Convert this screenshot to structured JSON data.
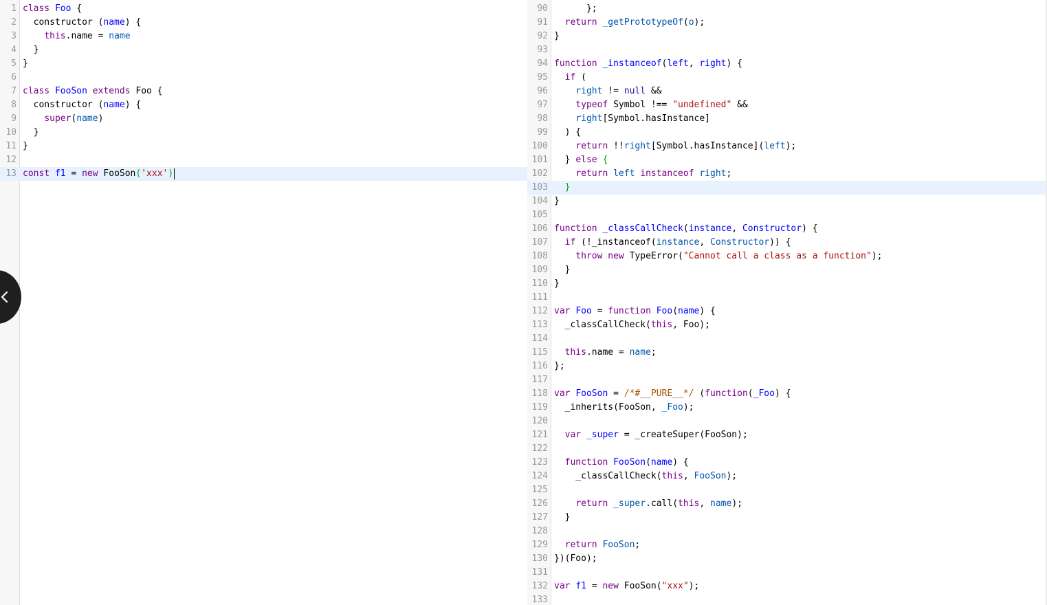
{
  "left_editor": {
    "active_line": "13",
    "lines": [
      {
        "no": "1",
        "tokens": [
          {
            "t": "class",
            "c": "keyword"
          },
          {
            "t": " "
          },
          {
            "t": "Foo",
            "c": "def"
          },
          {
            "t": " {"
          }
        ]
      },
      {
        "no": "2",
        "tokens": [
          {
            "t": "  constructor "
          },
          {
            "t": "("
          },
          {
            "t": "name",
            "c": "def"
          },
          {
            "t": ") {"
          }
        ]
      },
      {
        "no": "3",
        "tokens": [
          {
            "t": "    "
          },
          {
            "t": "this",
            "c": "keyword"
          },
          {
            "t": ".name = "
          },
          {
            "t": "name",
            "c": "var2"
          }
        ]
      },
      {
        "no": "4",
        "tokens": [
          {
            "t": "  }"
          }
        ]
      },
      {
        "no": "5",
        "tokens": [
          {
            "t": "}"
          }
        ]
      },
      {
        "no": "6",
        "tokens": []
      },
      {
        "no": "7",
        "tokens": [
          {
            "t": "class",
            "c": "keyword"
          },
          {
            "t": " "
          },
          {
            "t": "FooSon",
            "c": "def"
          },
          {
            "t": " "
          },
          {
            "t": "extends",
            "c": "keyword"
          },
          {
            "t": " Foo {"
          }
        ]
      },
      {
        "no": "8",
        "tokens": [
          {
            "t": "  constructor "
          },
          {
            "t": "("
          },
          {
            "t": "name",
            "c": "def"
          },
          {
            "t": ") {"
          }
        ]
      },
      {
        "no": "9",
        "tokens": [
          {
            "t": "    "
          },
          {
            "t": "super",
            "c": "keyword"
          },
          {
            "t": "("
          },
          {
            "t": "name",
            "c": "var2"
          },
          {
            "t": ")"
          }
        ]
      },
      {
        "no": "10",
        "tokens": [
          {
            "t": "  }"
          }
        ]
      },
      {
        "no": "11",
        "tokens": [
          {
            "t": "}"
          }
        ]
      },
      {
        "no": "12",
        "tokens": []
      },
      {
        "no": "13",
        "tokens": [
          {
            "t": "const",
            "c": "keyword"
          },
          {
            "t": " "
          },
          {
            "t": "f1",
            "c": "def"
          },
          {
            "t": " = "
          },
          {
            "t": "new",
            "c": "keyword"
          },
          {
            "t": " FooSon"
          },
          {
            "t": "(",
            "c": "bracket-match"
          },
          {
            "t": "'xxx'",
            "c": "str"
          },
          {
            "t": ")",
            "c": "bracket-match"
          }
        ],
        "cursor": true
      }
    ]
  },
  "right_editor": {
    "active_line": "103",
    "lines": [
      {
        "no": "90",
        "tokens": [
          {
            "t": "      };"
          }
        ]
      },
      {
        "no": "91",
        "tokens": [
          {
            "t": "  "
          },
          {
            "t": "return",
            "c": "keyword"
          },
          {
            "t": " "
          },
          {
            "t": "_getPrototypeOf",
            "c": "var2"
          },
          {
            "t": "("
          },
          {
            "t": "o",
            "c": "var2"
          },
          {
            "t": ");"
          }
        ]
      },
      {
        "no": "92",
        "tokens": [
          {
            "t": "}"
          }
        ]
      },
      {
        "no": "93",
        "tokens": []
      },
      {
        "no": "94",
        "tokens": [
          {
            "t": "function",
            "c": "keyword"
          },
          {
            "t": " "
          },
          {
            "t": "_instanceof",
            "c": "def"
          },
          {
            "t": "("
          },
          {
            "t": "left",
            "c": "def"
          },
          {
            "t": ", "
          },
          {
            "t": "right",
            "c": "def"
          },
          {
            "t": ") {"
          }
        ]
      },
      {
        "no": "95",
        "tokens": [
          {
            "t": "  "
          },
          {
            "t": "if",
            "c": "keyword"
          },
          {
            "t": " ("
          }
        ]
      },
      {
        "no": "96",
        "tokens": [
          {
            "t": "    "
          },
          {
            "t": "right",
            "c": "var2"
          },
          {
            "t": " != "
          },
          {
            "t": "null",
            "c": "atom"
          },
          {
            "t": " &&"
          }
        ]
      },
      {
        "no": "97",
        "tokens": [
          {
            "t": "    "
          },
          {
            "t": "typeof",
            "c": "keyword"
          },
          {
            "t": " Symbol !== "
          },
          {
            "t": "\"undefined\"",
            "c": "str"
          },
          {
            "t": " &&"
          }
        ]
      },
      {
        "no": "98",
        "tokens": [
          {
            "t": "    "
          },
          {
            "t": "right",
            "c": "var2"
          },
          {
            "t": "[Symbol.hasInstance]"
          }
        ]
      },
      {
        "no": "99",
        "tokens": [
          {
            "t": "  ) {"
          }
        ]
      },
      {
        "no": "100",
        "tokens": [
          {
            "t": "    "
          },
          {
            "t": "return",
            "c": "keyword"
          },
          {
            "t": " !!"
          },
          {
            "t": "right",
            "c": "var2"
          },
          {
            "t": "[Symbol.hasInstance]("
          },
          {
            "t": "left",
            "c": "var2"
          },
          {
            "t": ");"
          }
        ]
      },
      {
        "no": "101",
        "tokens": [
          {
            "t": "  } "
          },
          {
            "t": "else",
            "c": "keyword"
          },
          {
            "t": " "
          },
          {
            "t": "{",
            "c": "bracket-match"
          }
        ]
      },
      {
        "no": "102",
        "tokens": [
          {
            "t": "    "
          },
          {
            "t": "return",
            "c": "keyword"
          },
          {
            "t": " "
          },
          {
            "t": "left",
            "c": "var2"
          },
          {
            "t": " "
          },
          {
            "t": "instanceof",
            "c": "keyword"
          },
          {
            "t": " "
          },
          {
            "t": "right",
            "c": "var2"
          },
          {
            "t": ";"
          }
        ]
      },
      {
        "no": "103",
        "tokens": [
          {
            "t": "  "
          },
          {
            "t": "}",
            "c": "bracket-match"
          }
        ]
      },
      {
        "no": "104",
        "tokens": [
          {
            "t": "}"
          }
        ]
      },
      {
        "no": "105",
        "tokens": []
      },
      {
        "no": "106",
        "tokens": [
          {
            "t": "function",
            "c": "keyword"
          },
          {
            "t": " "
          },
          {
            "t": "_classCallCheck",
            "c": "def"
          },
          {
            "t": "("
          },
          {
            "t": "instance",
            "c": "def"
          },
          {
            "t": ", "
          },
          {
            "t": "Constructor",
            "c": "def"
          },
          {
            "t": ") {"
          }
        ]
      },
      {
        "no": "107",
        "tokens": [
          {
            "t": "  "
          },
          {
            "t": "if",
            "c": "keyword"
          },
          {
            "t": " (!_instanceof("
          },
          {
            "t": "instance",
            "c": "var2"
          },
          {
            "t": ", "
          },
          {
            "t": "Constructor",
            "c": "var2"
          },
          {
            "t": ")) {"
          }
        ]
      },
      {
        "no": "108",
        "tokens": [
          {
            "t": "    "
          },
          {
            "t": "throw",
            "c": "keyword"
          },
          {
            "t": " "
          },
          {
            "t": "new",
            "c": "keyword"
          },
          {
            "t": " TypeError("
          },
          {
            "t": "\"Cannot call a class as a function\"",
            "c": "str"
          },
          {
            "t": ");"
          }
        ]
      },
      {
        "no": "109",
        "tokens": [
          {
            "t": "  }"
          }
        ]
      },
      {
        "no": "110",
        "tokens": [
          {
            "t": "}"
          }
        ]
      },
      {
        "no": "111",
        "tokens": []
      },
      {
        "no": "112",
        "tokens": [
          {
            "t": "var",
            "c": "keyword"
          },
          {
            "t": " "
          },
          {
            "t": "Foo",
            "c": "def"
          },
          {
            "t": " = "
          },
          {
            "t": "function",
            "c": "keyword"
          },
          {
            "t": " "
          },
          {
            "t": "Foo",
            "c": "def"
          },
          {
            "t": "("
          },
          {
            "t": "name",
            "c": "def"
          },
          {
            "t": ") {"
          }
        ]
      },
      {
        "no": "113",
        "tokens": [
          {
            "t": "  _classCallCheck("
          },
          {
            "t": "this",
            "c": "keyword"
          },
          {
            "t": ", Foo);"
          }
        ]
      },
      {
        "no": "114",
        "tokens": []
      },
      {
        "no": "115",
        "tokens": [
          {
            "t": "  "
          },
          {
            "t": "this",
            "c": "keyword"
          },
          {
            "t": ".name = "
          },
          {
            "t": "name",
            "c": "var2"
          },
          {
            "t": ";"
          }
        ]
      },
      {
        "no": "116",
        "tokens": [
          {
            "t": "};"
          }
        ]
      },
      {
        "no": "117",
        "tokens": []
      },
      {
        "no": "118",
        "tokens": [
          {
            "t": "var",
            "c": "keyword"
          },
          {
            "t": " "
          },
          {
            "t": "FooSon",
            "c": "def"
          },
          {
            "t": " = "
          },
          {
            "t": "/*#__PURE__*/",
            "c": "comment"
          },
          {
            "t": " ("
          },
          {
            "t": "function",
            "c": "keyword"
          },
          {
            "t": "("
          },
          {
            "t": "_Foo",
            "c": "def"
          },
          {
            "t": ") {"
          }
        ]
      },
      {
        "no": "119",
        "tokens": [
          {
            "t": "  _inherits(FooSon, "
          },
          {
            "t": "_Foo",
            "c": "var2"
          },
          {
            "t": ");"
          }
        ]
      },
      {
        "no": "120",
        "tokens": []
      },
      {
        "no": "121",
        "tokens": [
          {
            "t": "  "
          },
          {
            "t": "var",
            "c": "keyword"
          },
          {
            "t": " "
          },
          {
            "t": "_super",
            "c": "def"
          },
          {
            "t": " = _createSuper(FooSon);"
          }
        ]
      },
      {
        "no": "122",
        "tokens": []
      },
      {
        "no": "123",
        "tokens": [
          {
            "t": "  "
          },
          {
            "t": "function",
            "c": "keyword"
          },
          {
            "t": " "
          },
          {
            "t": "FooSon",
            "c": "def"
          },
          {
            "t": "("
          },
          {
            "t": "name",
            "c": "def"
          },
          {
            "t": ") {"
          }
        ]
      },
      {
        "no": "124",
        "tokens": [
          {
            "t": "    _classCallCheck("
          },
          {
            "t": "this",
            "c": "keyword"
          },
          {
            "t": ", "
          },
          {
            "t": "FooSon",
            "c": "var2"
          },
          {
            "t": ");"
          }
        ]
      },
      {
        "no": "125",
        "tokens": []
      },
      {
        "no": "126",
        "tokens": [
          {
            "t": "    "
          },
          {
            "t": "return",
            "c": "keyword"
          },
          {
            "t": " "
          },
          {
            "t": "_super",
            "c": "var2"
          },
          {
            "t": ".call("
          },
          {
            "t": "this",
            "c": "keyword"
          },
          {
            "t": ", "
          },
          {
            "t": "name",
            "c": "var2"
          },
          {
            "t": ");"
          }
        ]
      },
      {
        "no": "127",
        "tokens": [
          {
            "t": "  }"
          }
        ]
      },
      {
        "no": "128",
        "tokens": []
      },
      {
        "no": "129",
        "tokens": [
          {
            "t": "  "
          },
          {
            "t": "return",
            "c": "keyword"
          },
          {
            "t": " "
          },
          {
            "t": "FooSon",
            "c": "var2"
          },
          {
            "t": ";"
          }
        ]
      },
      {
        "no": "130",
        "tokens": [
          {
            "t": "})(Foo);"
          }
        ]
      },
      {
        "no": "131",
        "tokens": []
      },
      {
        "no": "132",
        "tokens": [
          {
            "t": "var",
            "c": "keyword"
          },
          {
            "t": " "
          },
          {
            "t": "f1",
            "c": "def"
          },
          {
            "t": " = "
          },
          {
            "t": "new",
            "c": "keyword"
          },
          {
            "t": " FooSon("
          },
          {
            "t": "\"xxx\"",
            "c": "str"
          },
          {
            "t": ");"
          }
        ]
      },
      {
        "no": "133",
        "tokens": []
      }
    ]
  },
  "sidebar_toggle": {
    "icon": "chevron-left-icon"
  },
  "colors": {
    "keyword": "#770088",
    "def": "#0000ff",
    "variable_2": "#0055aa",
    "string": "#aa1111",
    "comment": "#aa5500",
    "atom": "#221199",
    "bracket_match": "#00aa00",
    "line_number": "#999999",
    "active_line": "#e8f2ff"
  }
}
